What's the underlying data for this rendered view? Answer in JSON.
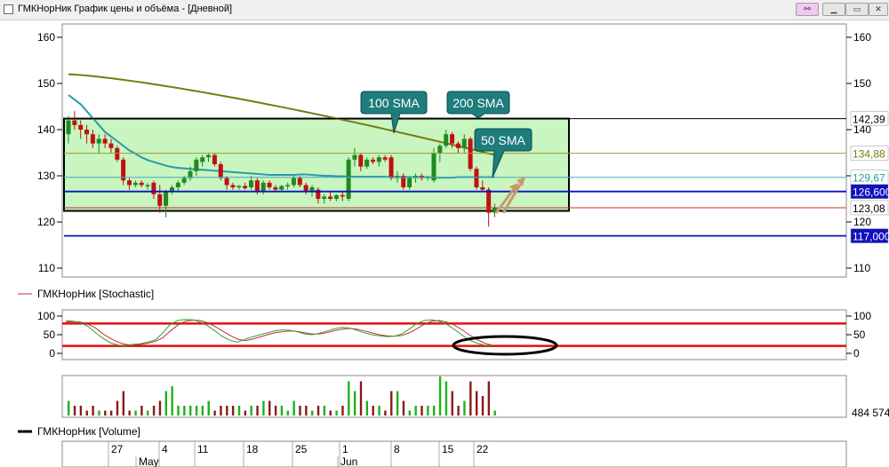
{
  "window": {
    "title": "ГМКНорНик График цены и объёма - [Дневной]",
    "buttons": [
      {
        "name": "pin-button",
        "glyph": "⚯"
      },
      {
        "name": "minimize-button",
        "glyph": "▁"
      },
      {
        "name": "restore-button",
        "glyph": "▭"
      },
      {
        "name": "close-button",
        "glyph": "✕"
      }
    ]
  },
  "price_panel": {
    "y_ticks": [
      160,
      150,
      140,
      130,
      120,
      110
    ],
    "sma_callouts": [
      "100 SMA",
      "200 SMA",
      "50 SMA"
    ],
    "price_labels": [
      {
        "value": "142,39",
        "y": 142.39,
        "color": "#000000",
        "bg": "#ffffff",
        "line": "#000000"
      },
      {
        "value": "134,88",
        "y": 134.88,
        "color": "#7a7a10",
        "bg": "#ffffff",
        "line": "#a0a030"
      },
      {
        "value": "129,67",
        "y": 129.67,
        "color": "#2a9aa8",
        "bg": "#ffffff",
        "line": "#45b0bc"
      },
      {
        "value": "126,600",
        "y": 126.6,
        "color": "#ffffff",
        "bg": "#1010c0",
        "line": "#1010c0"
      },
      {
        "value": "123,08",
        "y": 123.08,
        "color": "#000000",
        "bg": "#ffffff",
        "line": "#c03030"
      },
      {
        "value": "117,000",
        "y": 117.0,
        "color": "#ffffff",
        "bg": "#1010c0",
        "line": "#1010c0"
      }
    ]
  },
  "stochastic_panel": {
    "legend": "ГМКНорНик [Stochastic]",
    "y_ticks": [
      100,
      50,
      0
    ],
    "levels": [
      80,
      20
    ]
  },
  "volume_panel": {
    "legend": "ГМКНорНик [Volume]",
    "last_volume": "484 574"
  },
  "date_axis": {
    "days": [
      "27",
      "4",
      "11",
      "18",
      "25",
      "1",
      "8",
      "15",
      "22"
    ],
    "months": [
      "May",
      "Jun"
    ]
  },
  "colors": {
    "up": "#208a20",
    "down": "#c01010",
    "volume_up": "#20b020",
    "volume_down": "#8a1a1a",
    "sma50": "#2a9aa8",
    "sma100": "#7a7a10",
    "callout": "#1a7a7a",
    "box_fill": "#c8f5c0",
    "arrow": "#c89870"
  },
  "chart_data": {
    "type": "candlestick",
    "candles": [
      {
        "o": 139,
        "h": 143,
        "l": 137,
        "c": 142
      },
      {
        "o": 142,
        "h": 144,
        "l": 140,
        "c": 141
      },
      {
        "o": 141,
        "h": 142,
        "l": 138,
        "c": 140
      },
      {
        "o": 140,
        "h": 141,
        "l": 137,
        "c": 139
      },
      {
        "o": 139,
        "h": 140,
        "l": 136,
        "c": 137
      },
      {
        "o": 137,
        "h": 139,
        "l": 135,
        "c": 138
      },
      {
        "o": 138,
        "h": 139,
        "l": 136,
        "c": 137
      },
      {
        "o": 137,
        "h": 138,
        "l": 135,
        "c": 136
      },
      {
        "o": 136,
        "h": 136.5,
        "l": 133,
        "c": 133.5
      },
      {
        "o": 133.5,
        "h": 134,
        "l": 128,
        "c": 129
      },
      {
        "o": 129,
        "h": 129.5,
        "l": 127,
        "c": 128
      },
      {
        "o": 128,
        "h": 129,
        "l": 127.5,
        "c": 128.5
      },
      {
        "o": 128.5,
        "h": 129,
        "l": 127.5,
        "c": 128
      },
      {
        "o": 128,
        "h": 128.5,
        "l": 127,
        "c": 128
      },
      {
        "o": 128.5,
        "h": 129,
        "l": 125,
        "c": 126
      },
      {
        "o": 126,
        "h": 128,
        "l": 122,
        "c": 123.5
      },
      {
        "o": 123.5,
        "h": 127,
        "l": 121,
        "c": 126.5
      },
      {
        "o": 126.5,
        "h": 128,
        "l": 126,
        "c": 127.5
      },
      {
        "o": 127.5,
        "h": 129,
        "l": 126.5,
        "c": 128.5
      },
      {
        "o": 128.5,
        "h": 130,
        "l": 128,
        "c": 129.5
      },
      {
        "o": 129.5,
        "h": 132,
        "l": 129,
        "c": 131
      },
      {
        "o": 131,
        "h": 134,
        "l": 130,
        "c": 133.5
      },
      {
        "o": 133,
        "h": 134.5,
        "l": 132,
        "c": 134
      },
      {
        "o": 134,
        "h": 135,
        "l": 133,
        "c": 134.5
      },
      {
        "o": 134.5,
        "h": 135,
        "l": 132,
        "c": 132.5
      },
      {
        "o": 132.5,
        "h": 133,
        "l": 129,
        "c": 129.5
      },
      {
        "o": 129.5,
        "h": 130,
        "l": 127,
        "c": 128
      },
      {
        "o": 128,
        "h": 128.5,
        "l": 127,
        "c": 127.5
      },
      {
        "o": 127.5,
        "h": 128,
        "l": 127,
        "c": 127.8
      },
      {
        "o": 127.8,
        "h": 128.5,
        "l": 127,
        "c": 127.3
      },
      {
        "o": 127.5,
        "h": 130,
        "l": 127,
        "c": 129
      },
      {
        "o": 129,
        "h": 129.5,
        "l": 126,
        "c": 126.5
      },
      {
        "o": 126.5,
        "h": 129,
        "l": 126,
        "c": 128.5
      },
      {
        "o": 128.5,
        "h": 129,
        "l": 127,
        "c": 127.5
      },
      {
        "o": 127.5,
        "h": 128,
        "l": 126.5,
        "c": 127
      },
      {
        "o": 127,
        "h": 128,
        "l": 126.5,
        "c": 127.8
      },
      {
        "o": 127.8,
        "h": 128.5,
        "l": 127,
        "c": 128
      },
      {
        "o": 128,
        "h": 130,
        "l": 127.5,
        "c": 129.5
      },
      {
        "o": 129.5,
        "h": 130,
        "l": 127.5,
        "c": 128
      },
      {
        "o": 128,
        "h": 128.5,
        "l": 126,
        "c": 126.5
      },
      {
        "o": 126.5,
        "h": 128,
        "l": 125.5,
        "c": 127.5
      },
      {
        "o": 127,
        "h": 127.5,
        "l": 124,
        "c": 125
      },
      {
        "o": 125,
        "h": 126,
        "l": 124,
        "c": 125.5
      },
      {
        "o": 125.5,
        "h": 126.5,
        "l": 124.5,
        "c": 125
      },
      {
        "o": 125,
        "h": 126,
        "l": 124.5,
        "c": 125.8
      },
      {
        "o": 125.8,
        "h": 126.5,
        "l": 124.5,
        "c": 125.5
      },
      {
        "o": 125,
        "h": 134,
        "l": 124.5,
        "c": 133.5
      },
      {
        "o": 133.5,
        "h": 136,
        "l": 132,
        "c": 134.5
      },
      {
        "o": 134.5,
        "h": 135,
        "l": 131,
        "c": 132
      },
      {
        "o": 132,
        "h": 134,
        "l": 131.5,
        "c": 133.5
      },
      {
        "o": 133.5,
        "h": 134,
        "l": 132.5,
        "c": 133
      },
      {
        "o": 133,
        "h": 134.5,
        "l": 132,
        "c": 134
      },
      {
        "o": 134,
        "h": 134.5,
        "l": 133,
        "c": 133.5
      },
      {
        "o": 134,
        "h": 134.5,
        "l": 129,
        "c": 129.5
      },
      {
        "o": 129.5,
        "h": 131,
        "l": 128.5,
        "c": 130
      },
      {
        "o": 130,
        "h": 130.5,
        "l": 127,
        "c": 127.5
      },
      {
        "o": 127.5,
        "h": 130,
        "l": 127,
        "c": 129.5
      },
      {
        "o": 129.5,
        "h": 130.5,
        "l": 128.5,
        "c": 130
      },
      {
        "o": 130,
        "h": 130.5,
        "l": 129,
        "c": 129.5
      },
      {
        "o": 129.5,
        "h": 130,
        "l": 129,
        "c": 129.8
      },
      {
        "o": 129,
        "h": 136,
        "l": 128.5,
        "c": 135
      },
      {
        "o": 135,
        "h": 137,
        "l": 133,
        "c": 136.5
      },
      {
        "o": 136.5,
        "h": 140,
        "l": 136,
        "c": 139
      },
      {
        "o": 139,
        "h": 139.5,
        "l": 136,
        "c": 137
      },
      {
        "o": 137,
        "h": 137.5,
        "l": 135,
        "c": 136
      },
      {
        "o": 136,
        "h": 139,
        "l": 135,
        "c": 138
      },
      {
        "o": 138,
        "h": 138.5,
        "l": 131,
        "c": 131.5
      },
      {
        "o": 131.5,
        "h": 132,
        "l": 127,
        "c": 127.5
      },
      {
        "o": 127.5,
        "h": 129,
        "l": 126.5,
        "c": 127
      },
      {
        "o": 127,
        "h": 127.5,
        "l": 119,
        "c": 122
      },
      {
        "o": 122,
        "h": 124,
        "l": 121,
        "c": 123
      }
    ],
    "volume": [
      3,
      2,
      2,
      1,
      2,
      1,
      1,
      1,
      3,
      5,
      1,
      1,
      2,
      1,
      2,
      3,
      5,
      6,
      2,
      2,
      2,
      2,
      2,
      3,
      1,
      2,
      2,
      2,
      2,
      1,
      2,
      2,
      3,
      3,
      2,
      2,
      1,
      3,
      2,
      2,
      1,
      2,
      2,
      1,
      1,
      2,
      7,
      5,
      7,
      3,
      2,
      2,
      1,
      5,
      5,
      3,
      1,
      2,
      2,
      2,
      2,
      8,
      7,
      5,
      2,
      3,
      7,
      5,
      4,
      7,
      1
    ],
    "stoch_k": [
      88,
      86,
      82,
      72,
      55,
      40,
      28,
      22,
      20,
      24,
      26,
      30,
      36,
      55,
      78,
      88,
      91,
      90,
      84,
      74,
      60,
      45,
      35,
      30,
      38,
      44,
      50,
      55,
      60,
      63,
      62,
      58,
      52,
      50,
      54,
      60,
      66,
      70,
      68,
      62,
      55,
      50,
      47,
      45,
      46,
      52,
      65,
      80,
      88,
      90,
      86,
      78,
      65,
      50,
      36,
      28,
      22,
      20
    ],
    "stoch_d": [
      84,
      85,
      84,
      78,
      68,
      52,
      40,
      30,
      24,
      22,
      24,
      27,
      32,
      42,
      60,
      76,
      86,
      89,
      88,
      82,
      72,
      60,
      48,
      38,
      34,
      38,
      44,
      50,
      55,
      58,
      60,
      59,
      55,
      52,
      52,
      56,
      61,
      65,
      67,
      65,
      60,
      55,
      50,
      47,
      46,
      48,
      55,
      66,
      78,
      86,
      88,
      84,
      76,
      64,
      50,
      38,
      28,
      22
    ]
  }
}
